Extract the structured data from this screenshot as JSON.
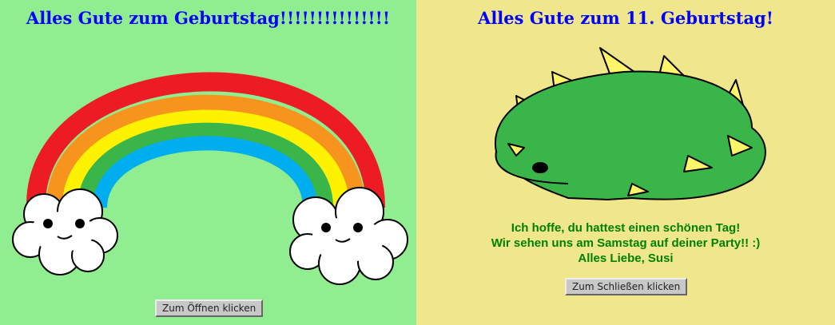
{
  "left_card": {
    "title": "Alles Gute zum Geburtstag!!!!!!!!!!!!!!!",
    "button_label": "Zum Öffnen klicken",
    "illustration": "rainbow-with-clouds",
    "background": "#90ee90"
  },
  "right_card": {
    "title": "Alles Gute zum 11. Geburtstag!",
    "message_lines": [
      "Ich hoffe, du hattest einen schönen Tag!",
      "Wir sehen uns am Samstag auf deiner Party!! :)",
      "Alles Liebe, Susi"
    ],
    "button_label": "Zum Schließen klicken",
    "illustration": "stegosaurus",
    "background": "#f0e68c"
  }
}
